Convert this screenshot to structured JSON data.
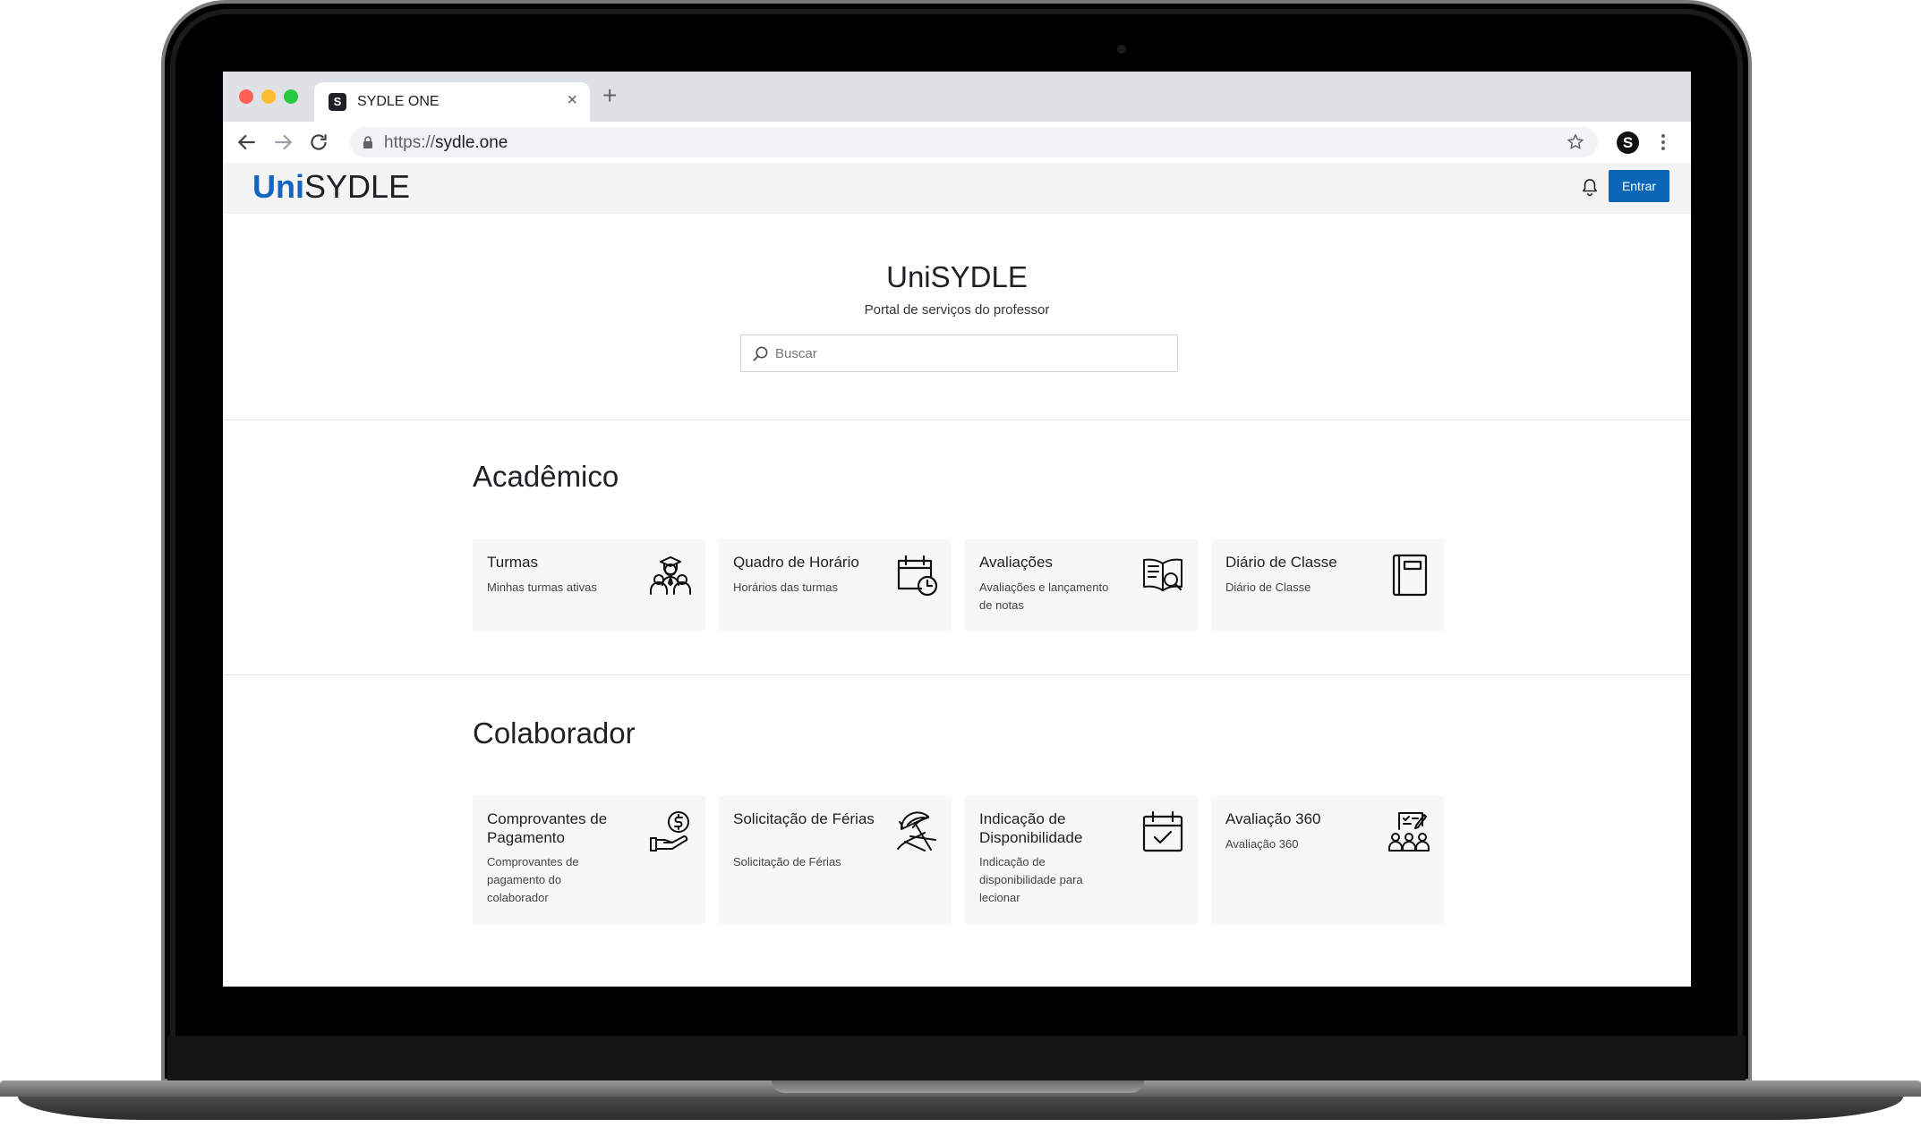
{
  "browser": {
    "tab_title": "SYDLE ONE",
    "tab_favicon": "S",
    "tab_close": "×",
    "new_tab": "+",
    "url_scheme": "https://",
    "url_host": "sydle.one",
    "profile_letter": "S",
    "icons": [
      "back-arrow-icon",
      "forward-arrow-icon",
      "reload-icon",
      "lock-icon",
      "star-icon",
      "kebab-menu-icon"
    ]
  },
  "header": {
    "logo_uni": "Uni",
    "logo_rest": "SYDLE",
    "login_label": "Entrar",
    "accent_color": "#0a66b7"
  },
  "hero": {
    "title": "UniSYDLE",
    "subtitle": "Portal de serviços do professor",
    "search_placeholder": "Buscar"
  },
  "sections": [
    {
      "title": "Acadêmico",
      "cards": [
        {
          "title": "Turmas",
          "description": "Minhas turmas ativas",
          "icon": "graduates-icon"
        },
        {
          "title": "Quadro de Horário",
          "description": "Horários das turmas",
          "icon": "calendar-clock-icon"
        },
        {
          "title": "Avaliações",
          "description": "Avaliações e lançamento de notas",
          "icon": "book-search-icon"
        },
        {
          "title": "Diário de Classe",
          "description": "Diário de Classe",
          "icon": "notebook-icon"
        }
      ]
    },
    {
      "title": "Colaborador",
      "cards": [
        {
          "title": "Comprovantes de Pagamento",
          "description": "Comprovantes de pagamento do colaborador",
          "icon": "hand-dollar-icon"
        },
        {
          "title": "Solicitação de Férias",
          "description": "Solicitação de Férias",
          "icon": "beach-umbrella-icon"
        },
        {
          "title": "Indicação de Disponibilidade",
          "description": "Indicação de disponibilidade para lecionar",
          "icon": "calendar-check-icon"
        },
        {
          "title": "Avaliação 360",
          "description": "Avaliação 360",
          "icon": "team-evaluation-icon"
        }
      ]
    }
  ]
}
